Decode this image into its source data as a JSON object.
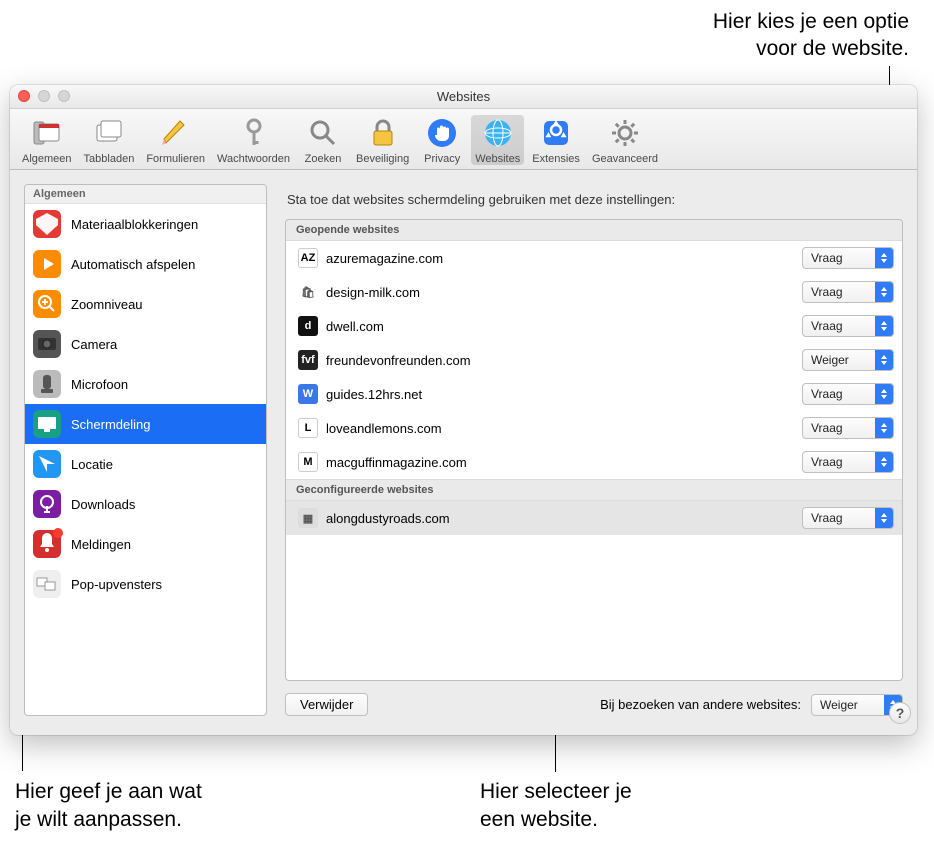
{
  "callouts": {
    "top": "Hier kies je een optie\nvoor de website.",
    "bottom_left": "Hier geef je aan wat\nje wilt aanpassen.",
    "bottom_right": "Hier selecteer je\neen website."
  },
  "window": {
    "title": "Websites",
    "toolbar": [
      {
        "label": "Algemeen",
        "icon": "switch"
      },
      {
        "label": "Tabbladen",
        "icon": "tabs"
      },
      {
        "label": "Formulieren",
        "icon": "pencil"
      },
      {
        "label": "Wachtwoorden",
        "icon": "key"
      },
      {
        "label": "Zoeken",
        "icon": "search"
      },
      {
        "label": "Beveiliging",
        "icon": "lock"
      },
      {
        "label": "Privacy",
        "icon": "hand"
      },
      {
        "label": "Websites",
        "icon": "globe",
        "selected": true
      },
      {
        "label": "Extensies",
        "icon": "extensions"
      },
      {
        "label": "Geavanceerd",
        "icon": "gear"
      }
    ]
  },
  "sidebar": {
    "header": "Algemeen",
    "items": [
      {
        "label": "Materiaalblokkeringen"
      },
      {
        "label": "Automatisch afspelen"
      },
      {
        "label": "Zoomniveau"
      },
      {
        "label": "Camera"
      },
      {
        "label": "Microfoon"
      },
      {
        "label": "Schermdeling",
        "selected": true
      },
      {
        "label": "Locatie"
      },
      {
        "label": "Downloads"
      },
      {
        "label": "Meldingen",
        "badge": true
      },
      {
        "label": "Pop-upvensters"
      }
    ]
  },
  "main": {
    "heading": "Sta toe dat websites schermdeling gebruiken met deze instellingen:",
    "open_header": "Geopende websites",
    "open_sites": [
      {
        "domain": "azuremagazine.com",
        "option": "Vraag",
        "fav_text": "AZ",
        "fav_bg": "#fff",
        "fav_color": "#000"
      },
      {
        "domain": "design-milk.com",
        "option": "Vraag",
        "fav_text": "🛍",
        "fav_bg": "transparent",
        "fav_color": "#555"
      },
      {
        "domain": "dwell.com",
        "option": "Vraag",
        "fav_text": "d",
        "fav_bg": "#111",
        "fav_color": "#fff"
      },
      {
        "domain": "freundevonfreunden.com",
        "option": "Weiger",
        "fav_text": "fvf",
        "fav_bg": "#222",
        "fav_color": "#fff"
      },
      {
        "domain": "guides.12hrs.net",
        "option": "Vraag",
        "fav_text": "W",
        "fav_bg": "#3b78e7",
        "fav_color": "#fff"
      },
      {
        "domain": "loveandlemons.com",
        "option": "Vraag",
        "fav_text": "L",
        "fav_bg": "#fff",
        "fav_color": "#000"
      },
      {
        "domain": "macguffinmagazine.com",
        "option": "Vraag",
        "fav_text": "M",
        "fav_bg": "#fff",
        "fav_color": "#000"
      }
    ],
    "config_header": "Geconfigureerde websites",
    "config_sites": [
      {
        "domain": "alongdustyroads.com",
        "option": "Vraag",
        "fav_text": "▦",
        "fav_bg": "#ddd",
        "fav_color": "#555",
        "selected": true
      }
    ],
    "remove_btn": "Verwijder",
    "other_label": "Bij bezoeken van andere websites:",
    "other_option": "Weiger"
  }
}
